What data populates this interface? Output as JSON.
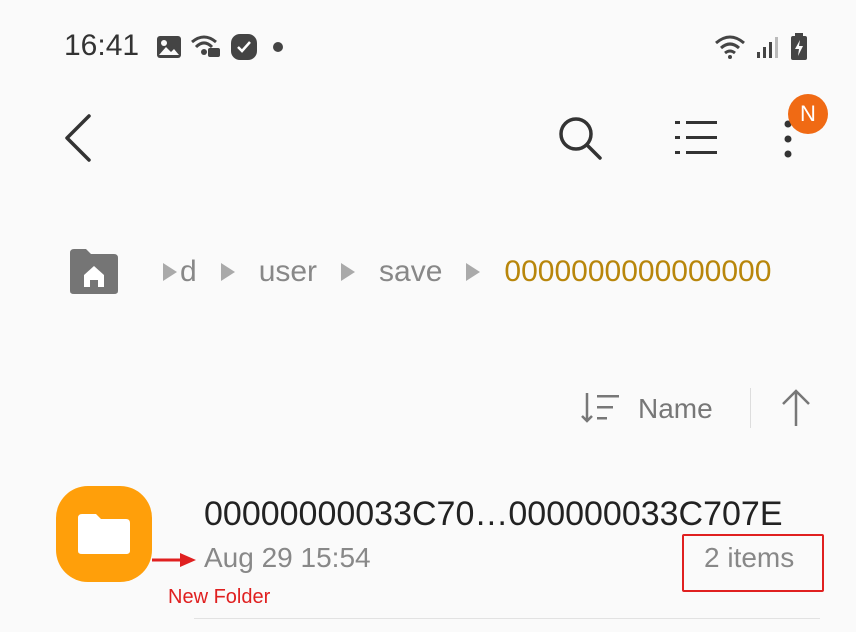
{
  "status_bar": {
    "time": "16:41",
    "icons": [
      "image-icon",
      "wifi-call-icon",
      "check-badge-icon",
      "dot-icon"
    ],
    "right_icons": [
      "wifi-icon",
      "signal-icon",
      "battery-charging-icon"
    ]
  },
  "toolbar": {
    "back_icon": "chevron-left-icon",
    "search_icon": "search-icon",
    "list_icon": "list-view-icon",
    "more_icon": "more-vertical-icon",
    "badge_letter": "N",
    "badge_color": "#f06a14"
  },
  "breadcrumb": {
    "home_icon": "home-folder-icon",
    "items": [
      {
        "label": "d"
      },
      {
        "label": "user"
      },
      {
        "label": "save"
      },
      {
        "label": "0000000000000000",
        "active": true
      }
    ],
    "active_color": "#b8860b"
  },
  "sort": {
    "label": "Name",
    "icon": "sort-icon",
    "direction_icon": "arrow-up-icon"
  },
  "files": [
    {
      "name": "00000000033C70…000000033C707E",
      "date": "Aug 29 15:54",
      "count": "2 items",
      "icon": "folder-icon",
      "icon_color": "#ff9f0a"
    }
  ],
  "annotation": {
    "label": "New Folder",
    "color": "#e02020"
  }
}
